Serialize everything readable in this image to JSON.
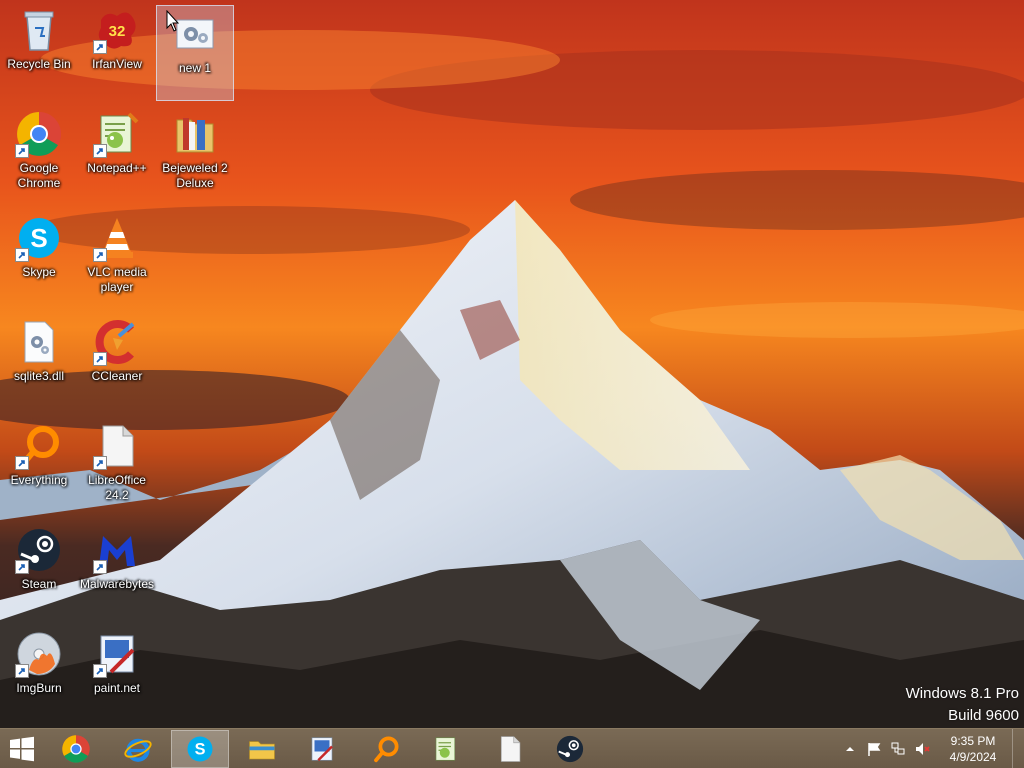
{
  "desktop": {
    "icons": [
      {
        "label": "Recycle Bin",
        "icon": "recycle-bin-icon"
      },
      {
        "label": "IrfanView",
        "icon": "irfanview-icon",
        "badge": "32"
      },
      {
        "label": "new 1",
        "icon": "settings-file-icon"
      },
      {
        "label": "Google\nChrome",
        "icon": "chrome-icon"
      },
      {
        "label": "Notepad++",
        "icon": "notepadpp-icon"
      },
      {
        "label": "Bejeweled 2\nDeluxe",
        "icon": "bejeweled-folder-icon"
      },
      {
        "label": "Skype",
        "icon": "skype-icon"
      },
      {
        "label": "VLC media\nplayer",
        "icon": "vlc-icon"
      },
      {
        "label": "sqlite3.dll",
        "icon": "dll-file-icon"
      },
      {
        "label": "CCleaner",
        "icon": "ccleaner-icon"
      },
      {
        "label": "Everything",
        "icon": "everything-search-icon"
      },
      {
        "label": "LibreOffice\n24.2",
        "icon": "libreoffice-icon"
      },
      {
        "label": "Steam",
        "icon": "steam-icon"
      },
      {
        "label": "Malwarebytes",
        "icon": "malwarebytes-icon"
      },
      {
        "label": "ImgBurn",
        "icon": "imgburn-icon"
      },
      {
        "label": "paint.net",
        "icon": "paintnet-icon"
      }
    ]
  },
  "watermark": {
    "line1": "Windows 8.1 Pro",
    "line2": "Build 9600"
  },
  "taskbar": {
    "pinned": [
      "start-icon",
      "chrome-icon",
      "internet-explorer-icon",
      "skype-icon",
      "file-explorer-icon",
      "paintnet-icon",
      "everything-search-icon",
      "notepadpp-icon",
      "libreoffice-icon",
      "steam-icon"
    ],
    "clock": {
      "time": "9:35 PM",
      "date": "4/9/2024"
    }
  },
  "colors": {
    "taskbar": "#6e5e4b",
    "accent": "#c8dcf5"
  }
}
